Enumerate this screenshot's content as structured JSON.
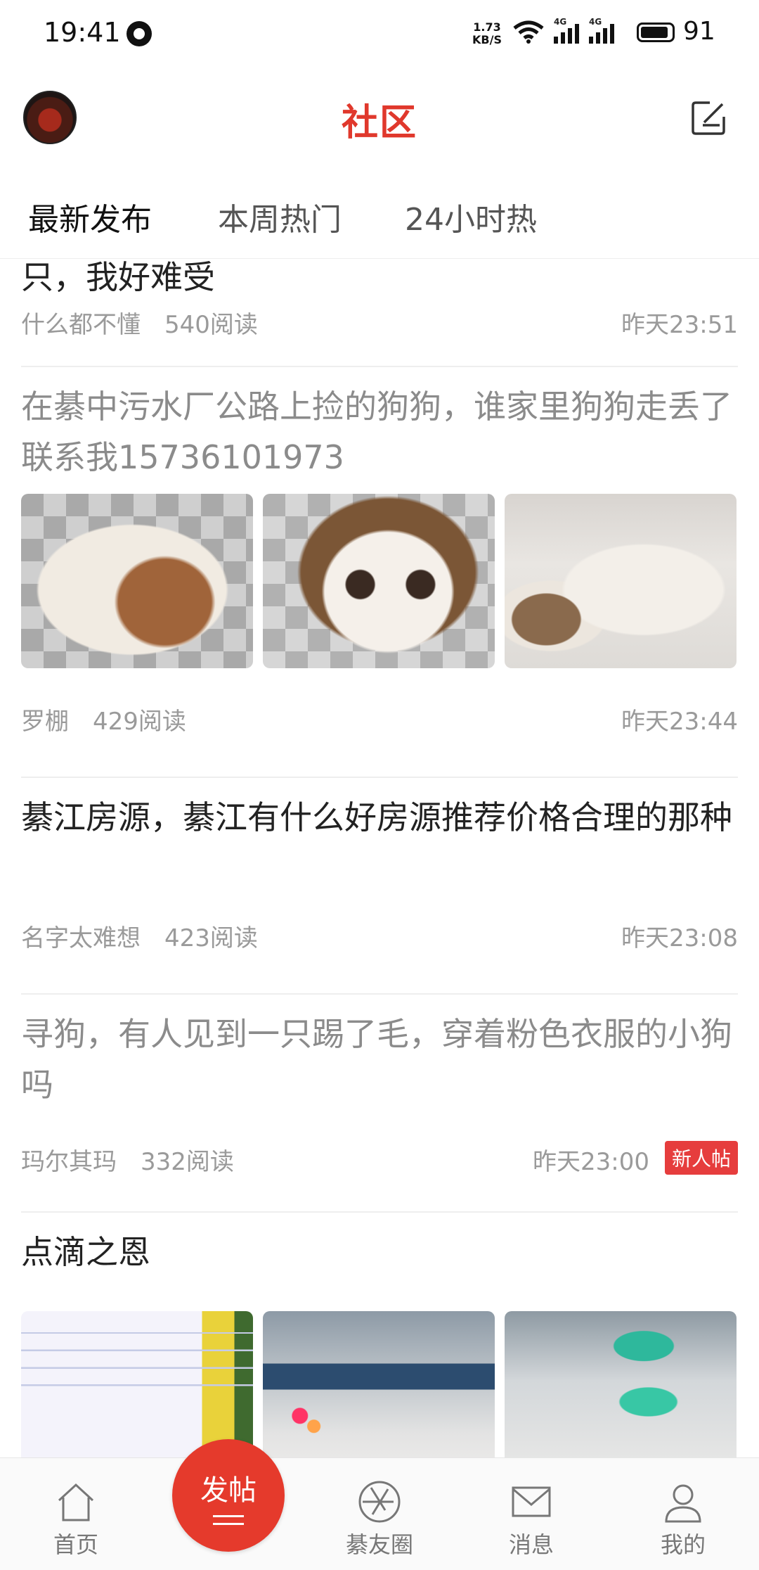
{
  "status_bar": {
    "time": "19:41",
    "speed_top": "1.73",
    "speed_bottom": "KB/S",
    "net1": "4G",
    "net2": "4G",
    "battery": "91"
  },
  "header": {
    "title": "社区"
  },
  "tabs": [
    {
      "label": "最新发布",
      "active": true
    },
    {
      "label": "本周热门",
      "active": false
    },
    {
      "label": "24小时热",
      "active": false
    }
  ],
  "feed": [
    {
      "title": "只，我好难受",
      "author": "什么都不懂",
      "reads": "540阅读",
      "time": "昨天23:51",
      "read": false
    },
    {
      "title": "在綦中污水厂公路上捡的狗狗，谁家里狗狗走丢了联系我15736101973",
      "author": "罗棚",
      "reads": "429阅读",
      "time": "昨天23:44",
      "read": true
    },
    {
      "title": "綦江房源，綦江有什么好房源推荐价格合理的那种",
      "author": "名字太难想",
      "reads": "423阅读",
      "time": "昨天23:08",
      "read": false
    },
    {
      "title": "寻狗，有人见到一只踢了毛，穿着粉色衣服的小狗吗",
      "author": "玛尔其玛",
      "reads": "332阅读",
      "time": "昨天23:00",
      "badge": "新人帖",
      "read": true
    },
    {
      "title": "点滴之恩",
      "read": false
    }
  ],
  "bottom_nav": {
    "home": "首页",
    "post": "发帖",
    "circle": "綦友圈",
    "messages": "消息",
    "mine": "我的"
  },
  "colors": {
    "brand_red": "#e0382c",
    "badge_red": "#e63d3d"
  }
}
